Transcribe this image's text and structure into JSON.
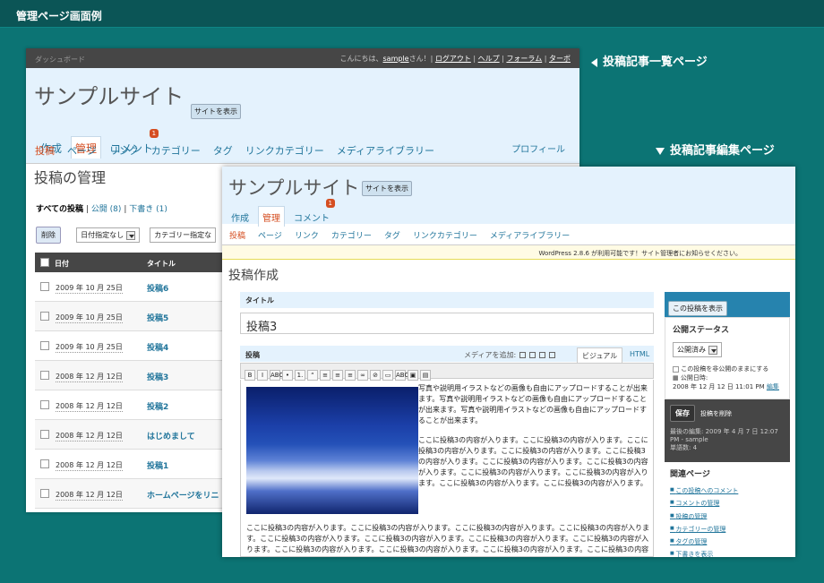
{
  "page_title": "管理ページ画面例",
  "caption_list": "投稿記事一覧ページ",
  "caption_edit": "投稿記事編集ページ",
  "list_window": {
    "admin_bar": {
      "left": "ダッシュボード",
      "greeting_pre": "こんにちは、",
      "user": "sample",
      "greeting_post": "さん！|",
      "logout": "ログアウト",
      "sep1": "|",
      "help": "ヘルプ",
      "sep2": "|",
      "forum": "フォーラム",
      "sep3": "|",
      "turbo": "ターボ"
    },
    "site_title": "サンプルサイト",
    "view_site": "サイトを表示",
    "tabs": [
      "作成",
      "管理",
      "コメント"
    ],
    "comment_count": "1",
    "profile": "プロフィール",
    "submenu": [
      "投稿",
      "ページ",
      "リンク",
      "カテゴリー",
      "タグ",
      "リンクカテゴリー",
      "メディアライブラリー"
    ],
    "heading": "投稿の管理",
    "filter_all": "すべての投稿",
    "filter_sep": "|",
    "filter_published": "公開 (8)",
    "filter_sep2": "|",
    "filter_draft": "下書き (1)",
    "delete_btn": "削除",
    "date_filter": "日付指定なし",
    "cat_filter": "カテゴリー指定な",
    "col_date": "日付",
    "col_title": "タイトル",
    "rows": [
      {
        "date": "2009 年 10 月 25日",
        "title": "投稿6"
      },
      {
        "date": "2009 年 10 月 25日",
        "title": "投稿5"
      },
      {
        "date": "2009 年 10 月 25日",
        "title": "投稿4"
      },
      {
        "date": "2008 年 12 月 12日",
        "title": "投稿3"
      },
      {
        "date": "2008 年 12 月 12日",
        "title": "投稿2"
      },
      {
        "date": "2008 年 12 月 12日",
        "title": "はじめまして"
      },
      {
        "date": "2008 年 12 月 12日",
        "title": "投稿1"
      },
      {
        "date": "2008 年 12 月 12日",
        "title": "ホームページをリニ"
      }
    ]
  },
  "edit_window": {
    "site_title": "サンプルサイト",
    "view_site": "サイトを表示",
    "tabs": [
      "作成",
      "管理",
      "コメント"
    ],
    "comment_count": "1",
    "submenu": [
      "投稿",
      "ページ",
      "リンク",
      "カテゴリー",
      "タグ",
      "リンクカテゴリー",
      "メディアライブラリー"
    ],
    "notice": "WordPress 2.8.6 が利用可能です！サイト管理者にお知らせください。",
    "heading": "投稿作成",
    "title_label": "タイトル",
    "title_value": "投稿3",
    "editor_label": "投稿",
    "media_label": "メディアを追加:",
    "tab_visual": "ビジュアル",
    "tab_html": "HTML",
    "toolbar": [
      "B",
      "I",
      "ABC",
      "•",
      "1.",
      "“",
      "≡",
      "≡",
      "≡",
      "∞",
      "⊘",
      "▭",
      "ABC",
      "▣",
      "▤"
    ],
    "body_p1": "写真や説明用イラストなどの画像も自由にアップロードすることが出来ます。写真や説明用イラストなどの画像も自由にアップロードすることが出来ます。写真や説明用イラストなどの画像も自由にアップロードすることが出来ます。",
    "body_p2": "ここに投稿3の内容が入ります。ここに投稿3の内容が入ります。ここに投稿3の内容が入ります。ここに投稿3の内容が入ります。ここに投稿3の内容が入ります。ここに投稿3の内容が入ります。ここに投稿3の内容が入ります。ここに投稿3の内容が入ります。ここに投稿3の内容が入ります。ここに投稿3の内容が入ります。ここに投稿3の内容が入ります。",
    "body_p3": "ここに投稿3の内容が入ります。ここに投稿3の内容が入ります。ここに投稿3の内容が入ります。ここに投稿3の内容が入ります。ここに投稿3の内容が入ります。ここに投稿3の内容が入ります。ここに投稿3の内容が入ります。ここに投稿3の内容が入ります。ここに投稿3の内容が入ります。ここに投稿3の内容が入ります。ここに投稿3の内容が入ります。ここに投稿3の内容が入ります。",
    "sidebar": {
      "view_post": "この投稿を表示",
      "status_title": "公開ステータス",
      "status_value": "公開済み",
      "keep_private": "この投稿を非公開のままにする",
      "published_on": "公開日時:",
      "published_date": "2008 年 12 月 12 日 11:01 PM",
      "edit_link": "編集",
      "save": "保存",
      "delete": "投稿を削除",
      "last_edit": "最後の編集: 2009 年 4 月 7 日 12:07 PM - sample",
      "word_count": "単語数: 4",
      "related_title": "関連ページ",
      "related": [
        "この投稿へのコメント",
        "コメントの管理",
        "投稿の管理",
        "カテゴリーの管理",
        "タグの管理",
        "下書きを表示"
      ]
    }
  }
}
